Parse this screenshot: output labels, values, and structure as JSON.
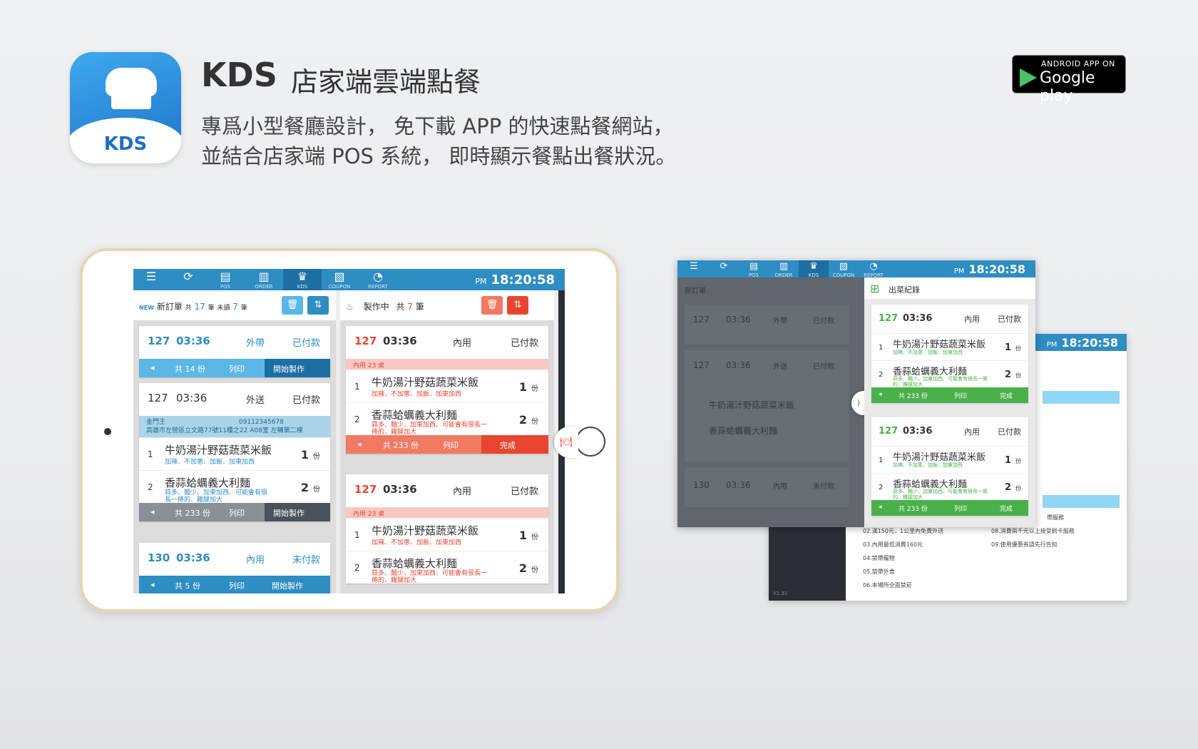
{
  "header": {
    "title": "KDS",
    "subtitle": "店家端雲端點餐",
    "desc_line1": "專爲小型餐廳設計， 免下載 APP 的快速點餐網站，",
    "desc_line2": "並結合店家端 POS 系統， 即時顯示餐點出餐狀況。",
    "icon_label": "KDS"
  },
  "google_play": {
    "line1": "ANDROID APP ON",
    "line2": "Google play"
  },
  "topbar": {
    "items": [
      {
        "icon": "menu-icon",
        "glyph": "☰",
        "label": ""
      },
      {
        "icon": "refresh-icon",
        "glyph": "⟳",
        "label": ""
      },
      {
        "icon": "pos-icon",
        "glyph": "▤",
        "label": "POS"
      },
      {
        "icon": "order-icon",
        "glyph": "▥",
        "label": "ORDER"
      },
      {
        "icon": "kds-icon",
        "glyph": "♛",
        "label": "KDS"
      },
      {
        "icon": "coupon-icon",
        "glyph": "▧",
        "label": "COUPON"
      },
      {
        "icon": "report-icon",
        "glyph": "◔",
        "label": "REPORT"
      }
    ],
    "ampm": "PM",
    "time": "18:20:58"
  },
  "new_orders": {
    "badge": "NEW",
    "title": "新訂單",
    "total_prefix": "共",
    "total": "17",
    "total_unit": "筆",
    "unread_prefix": "未讀",
    "unread": "7",
    "unread_unit": "筆"
  },
  "in_progress": {
    "title": "製作中",
    "total_prefix": "共",
    "total": "7",
    "total_unit": "筆"
  },
  "orders": [
    {
      "no": "127",
      "time": "03:36",
      "type": "外帶",
      "pay": "已付款",
      "count": "共 14 份",
      "print": "列印",
      "action": "開始製作"
    },
    {
      "no": "127",
      "time": "03:36",
      "type": "外送",
      "pay": "已付款",
      "customer": "金門王",
      "phone": "09112345678",
      "address": "高雄市左營區立文路77號11樓之22 A08室 左轉第二棟",
      "count": "共 233 份",
      "print": "列印",
      "action": "開始製作"
    },
    {
      "no": "130",
      "time": "03:36",
      "type": "內用",
      "pay": "未付款",
      "count": "共 5 份",
      "print": "列印",
      "action": "開始製作"
    }
  ],
  "progress_orders": [
    {
      "no": "127",
      "time": "03:36",
      "type": "內用",
      "pay": "已付款",
      "table": "內用 23 桌",
      "count": "共 233 份",
      "print": "列印",
      "action": "完成"
    },
    {
      "no": "127",
      "time": "03:36",
      "type": "內用",
      "pay": "已付款",
      "table": "內用 23 桌"
    }
  ],
  "items": [
    {
      "n": "1",
      "name": "牛奶湯汁野菇蔬菜米飯",
      "note": "加辣、不加蔥、加飯、加東加西",
      "qty": "1",
      "unit": "份"
    },
    {
      "n": "2",
      "name": "香蒜蛤蠣義大利麵",
      "note": "蒜多、麵少、加東加西、可能會有很長一條的、雞腿加大",
      "qty": "2",
      "unit": "份"
    }
  ],
  "served": {
    "title": "出菜紀錄",
    "cards": [
      {
        "no": "127",
        "time": "03:36",
        "type": "內用",
        "pay": "已付款",
        "count": "共 233 份",
        "print": "列印",
        "action": "完成"
      },
      {
        "no": "127",
        "time": "03:36",
        "type": "內用",
        "pay": "已付款",
        "count": "共 233 份",
        "print": "列印",
        "action": "完成"
      }
    ]
  },
  "dim_orders": [
    {
      "no": "127",
      "time": "03:36",
      "type": "外帶",
      "pay": "已付款"
    },
    {
      "no": "127",
      "time": "03:36",
      "type": "外送",
      "pay": "已付款"
    },
    {
      "no": "130",
      "time": "03:36",
      "type": "內用",
      "pay": "未付款"
    }
  ],
  "back_screen": {
    "ampm": "PM",
    "time": "18:20:58",
    "version": "V1.31",
    "rules_left": [
      "02.滿150元，1公里內免費外送",
      "03.內用最低消費160元",
      "04.禁帶寵物",
      "05.禁帶外食",
      "06.本場所全面禁菸"
    ],
    "rules_right": [
      "帶服務",
      "08.消費兩千元以上接受刷卡服務",
      "09.使用優惠券請先行告知"
    ]
  },
  "colors": {
    "brand_blue": "#2e8dc3",
    "alert_red": "#e8452f",
    "done_green": "#4bb04a"
  }
}
